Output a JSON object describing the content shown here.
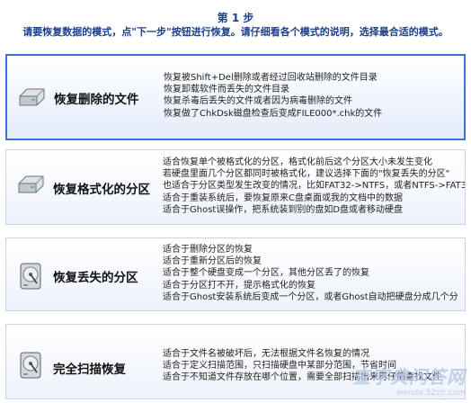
{
  "step_title": "第 1 步",
  "step_desc": "请要恢复数据的模式，点\"下一步\"按钮进行恢复。请仔细看各个模式的说明，选择最合适的模式。",
  "modes": [
    {
      "name": "恢复删除的文件",
      "icon": "hard-drive-icon",
      "selected": true,
      "lines": [
        "恢复被Shift+Del删除或者经过回收站删除的文件目录",
        "恢复卸载软件而丢失的文件目录",
        "恢复杀毒后丢失的文件或者因为病毒删除的文件",
        "恢复做了ChkDsk磁盘检查后变成FILE000*.chk的文件"
      ]
    },
    {
      "name": "恢复格式化的分区",
      "icon": "hard-drive-icon",
      "selected": false,
      "lines": [
        "适合恢复单个被格式化的分区，格式化前后这个分区大小未发生变化",
        "若硬盘里面几个分区都同时被格式化，建议选择下面的\"恢复丢失的分区\"",
        "也适合于分区类型发生改变的情况，比如FAT32->NTFS，或者NTFS->FAT3",
        "适合于重装系统后，要恢复原来C盘桌面或我的文档中的数据",
        "适合于Ghost误操作，把系统装到别的盘如D盘或者移动硬盘"
      ]
    },
    {
      "name": "恢复丢失的分区",
      "icon": "disk-platter-icon",
      "selected": false,
      "lines": [
        "适合于删除分区的恢复",
        "适合于重新分区后的恢复",
        "适合于整个硬盘变成一个分区，其他分区丢了的恢复",
        "适合于分区打不开，提示格式化的恢复",
        "适合于Ghost安装系统后变成一个分区，或者Ghost自动把硬盘分成几个分"
      ]
    },
    {
      "name": "完全扫描恢复",
      "icon": "disk-platter-icon",
      "selected": false,
      "lines": [
        "适合于文件名被破坏后，无法根据文件名恢复的情况",
        "适合于定义扫描范围，只扫描硬盘中某部分范围，节省时间",
        "适合于不知道文件存放在哪个位置，需要全部扫描出来再仔细查找文件"
      ]
    }
  ],
  "watermark": {
    "main": "查字典问答网",
    "url": "wenda.52zjt.com"
  }
}
